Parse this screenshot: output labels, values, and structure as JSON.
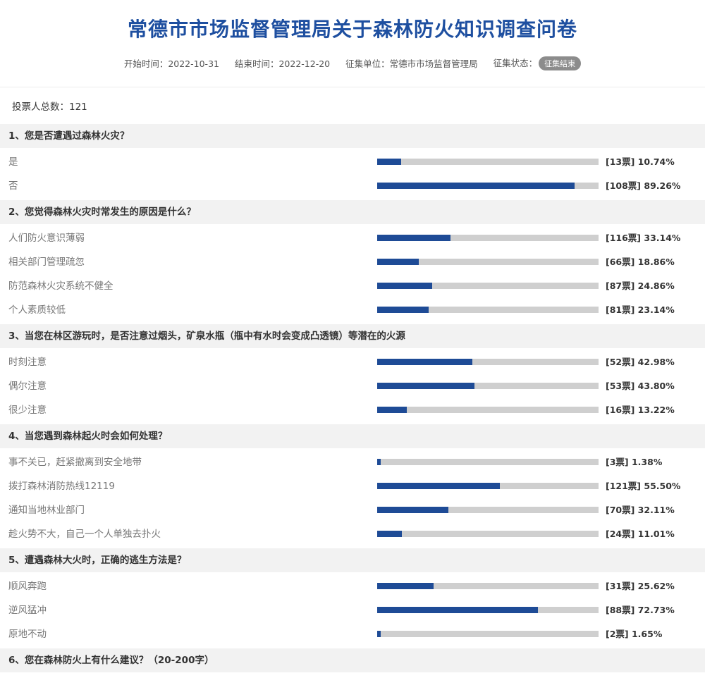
{
  "title": "常德市市场监督管理局关于森林防火知识调查问卷",
  "meta": {
    "start": "开始时间：2022-10-31",
    "end": "结束时间：2022-12-20",
    "unit": "征集单位：常德市市场监督管理局",
    "status_label": "征集状态：",
    "status_badge": "征集结束"
  },
  "total": "投票人总数：121",
  "colors": {
    "title": "#1e4fa0",
    "bar_fill": "#1e4b96",
    "bar_track": "#cfcfcf",
    "section_bg": "#f2f2f2"
  },
  "questions": [
    {
      "title": "1、您是否遭遇过森林火灾？",
      "options": [
        {
          "label": "是",
          "result": "[13票] 10.74%",
          "percent": 10.74
        },
        {
          "label": "否",
          "result": "[108票] 89.26%",
          "percent": 89.26
        }
      ]
    },
    {
      "title": "2、您觉得森林火灾时常发生的原因是什么？",
      "options": [
        {
          "label": "人们防火意识薄弱",
          "result": "[116票] 33.14%",
          "percent": 33.14
        },
        {
          "label": "相关部门管理疏忽",
          "result": "[66票] 18.86%",
          "percent": 18.86
        },
        {
          "label": "防范森林火灾系统不健全",
          "result": "[87票] 24.86%",
          "percent": 24.86
        },
        {
          "label": "个人素质较低",
          "result": "[81票] 23.14%",
          "percent": 23.14
        }
      ]
    },
    {
      "title": "3、当您在林区游玩时，是否注意过烟头，矿泉水瓶（瓶中有水时会变成凸透镜）等潜在的火源",
      "options": [
        {
          "label": "时刻注意",
          "result": "[52票] 42.98%",
          "percent": 42.98
        },
        {
          "label": "偶尔注意",
          "result": "[53票] 43.80%",
          "percent": 43.8
        },
        {
          "label": "很少注意",
          "result": "[16票] 13.22%",
          "percent": 13.22
        }
      ]
    },
    {
      "title": "4、当您遇到森林起火时会如何处理？",
      "options": [
        {
          "label": "事不关已，赶紧撤离到安全地带",
          "result": "[3票] 1.38%",
          "percent": 1.38
        },
        {
          "label": "拨打森林消防热线12119",
          "result": "[121票] 55.50%",
          "percent": 55.5
        },
        {
          "label": "通知当地林业部门",
          "result": "[70票] 32.11%",
          "percent": 32.11
        },
        {
          "label": "趁火势不大，自己一个人单独去扑火",
          "result": "[24票] 11.01%",
          "percent": 11.01
        }
      ]
    },
    {
      "title": "5、遭遇森林大火时，正确的逃生方法是？",
      "options": [
        {
          "label": "顺风奔跑",
          "result": "[31票] 25.62%",
          "percent": 25.62
        },
        {
          "label": "逆风猛冲",
          "result": "[88票] 72.73%",
          "percent": 72.73
        },
        {
          "label": "原地不动",
          "result": "[2票] 1.65%",
          "percent": 1.65
        }
      ]
    },
    {
      "title": "6、您在森林防火上有什么建议？（20-200字）",
      "options": []
    }
  ]
}
